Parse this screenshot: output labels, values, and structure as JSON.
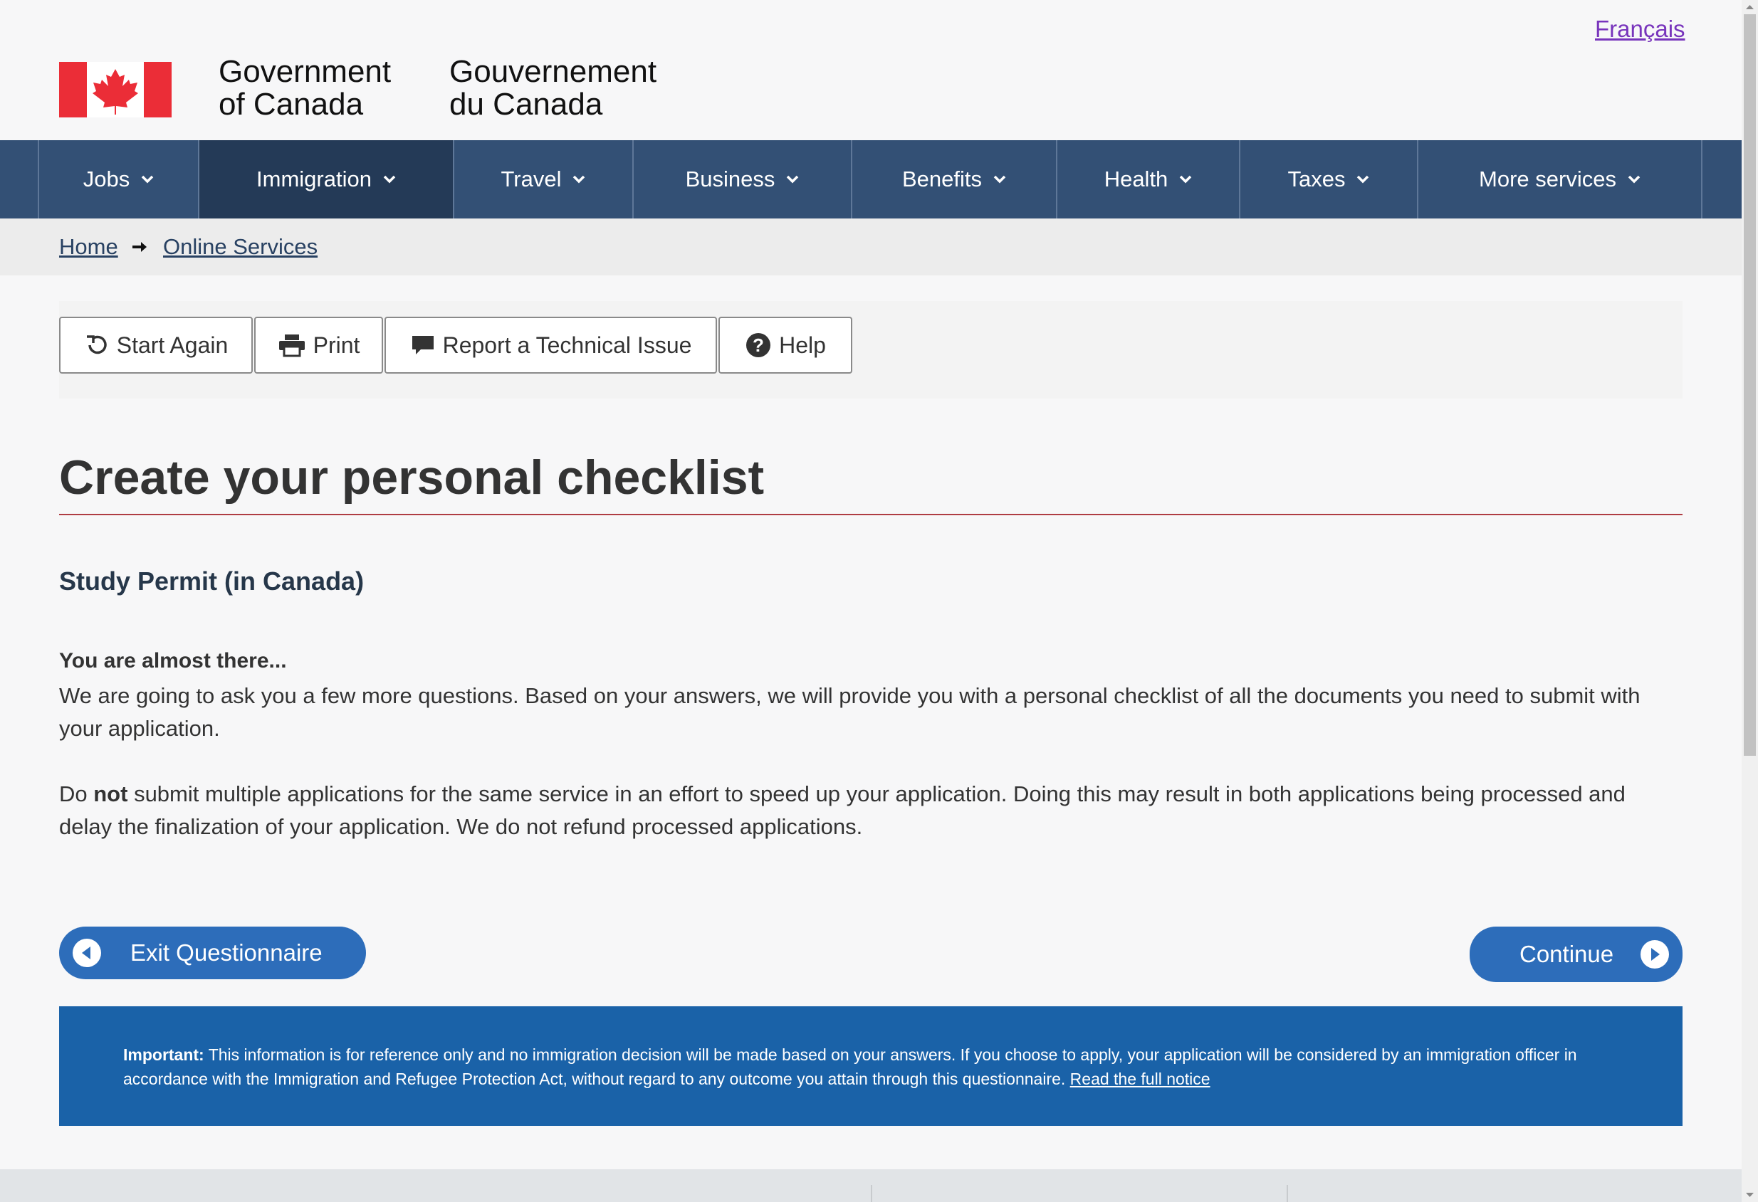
{
  "header": {
    "lang_toggle": "Français",
    "signature_en": [
      "Government",
      "of Canada"
    ],
    "signature_fr": [
      "Gouvernement",
      "du Canada"
    ]
  },
  "nav": {
    "items": [
      {
        "label": "Jobs"
      },
      {
        "label": "Immigration",
        "active": true
      },
      {
        "label": "Travel"
      },
      {
        "label": "Business"
      },
      {
        "label": "Benefits"
      },
      {
        "label": "Health"
      },
      {
        "label": "Taxes"
      },
      {
        "label": "More services"
      }
    ]
  },
  "breadcrumb": {
    "home": "Home",
    "current": "Online Services"
  },
  "toolbar": {
    "start_again": "Start Again",
    "print": "Print",
    "report": "Report a Technical Issue",
    "help": "Help"
  },
  "page": {
    "title": "Create your personal checklist",
    "subtitle": "Study Permit (in Canada)",
    "almost": "You are almost there...",
    "para1": "We are going to ask you a few more questions. Based on your answers, we will provide you with a personal checklist of all the documents you need to submit with your application.",
    "para2_prefix": "Do ",
    "para2_bold": "not",
    "para2_rest": " submit multiple applications for the same service in an effort to speed up your application.  Doing this may result in both applications being processed and delay the finalization of your application. We do not refund processed applications."
  },
  "actions": {
    "exit": "Exit Questionnaire",
    "continue": "Continue"
  },
  "notice": {
    "label": "Important:",
    "text": " This information is for reference only and no immigration decision will be made based on your answers. If you choose to apply, your application will be considered by an immigration officer in accordance with the Immigration and Refugee Protection Act, without regard to any outcome you attain through this questionnaire. ",
    "link": "Read the full notice"
  },
  "colors": {
    "nav_bg": "#335075",
    "nav_active": "#243a57",
    "title_rule": "#af3c43",
    "subtitle": "#26374a",
    "pill": "#2d6dba",
    "notice_bg": "#1a62a8",
    "lang_link": "#7834bc"
  },
  "icons": {
    "start_again": "refresh-icon",
    "print": "printer-icon",
    "report": "comment-icon",
    "help": "question-circle-icon",
    "exit": "circle-arrow-left-icon",
    "continue": "circle-arrow-right-icon"
  }
}
